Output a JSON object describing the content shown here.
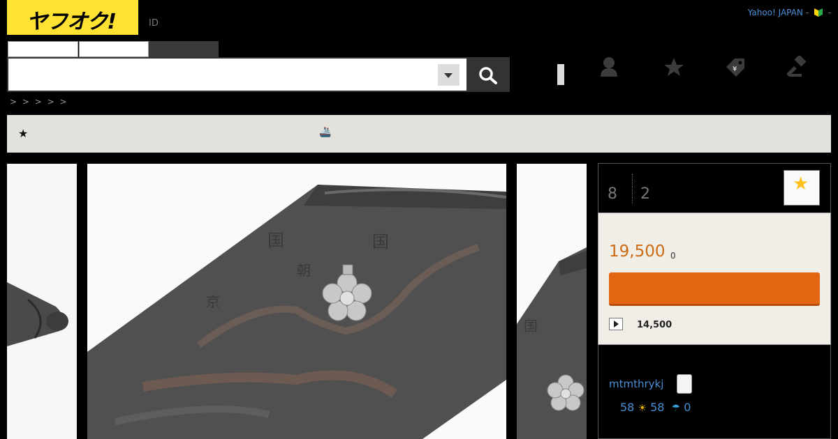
{
  "header": {
    "logo_text": "ヤフオク!",
    "id_link": "ID",
    "yahoo_japan": "Yahoo! JAPAN",
    "sep1": "-",
    "sep2": "-",
    "accent_color": "#ffe232"
  },
  "search": {
    "placeholder": "",
    "value": "",
    "button_icon": "search-icon"
  },
  "header_icons": [
    "user-icon",
    "star-icon",
    "tag-icon",
    "hammer-icon"
  ],
  "breadcrumb": "> > > > >",
  "notice": {
    "star": "★",
    "icon": "🚢"
  },
  "item": {
    "watch_count": "8",
    "bid_count": "2",
    "current_price": "19,500",
    "tax": "0",
    "start_price": "14,500",
    "price_color": "#cc6b14",
    "bid_button_color": "#e36712"
  },
  "seller": {
    "name": "mtmthrykj",
    "rating_total": "58",
    "rating_good": "58",
    "rating_bad": "0"
  }
}
